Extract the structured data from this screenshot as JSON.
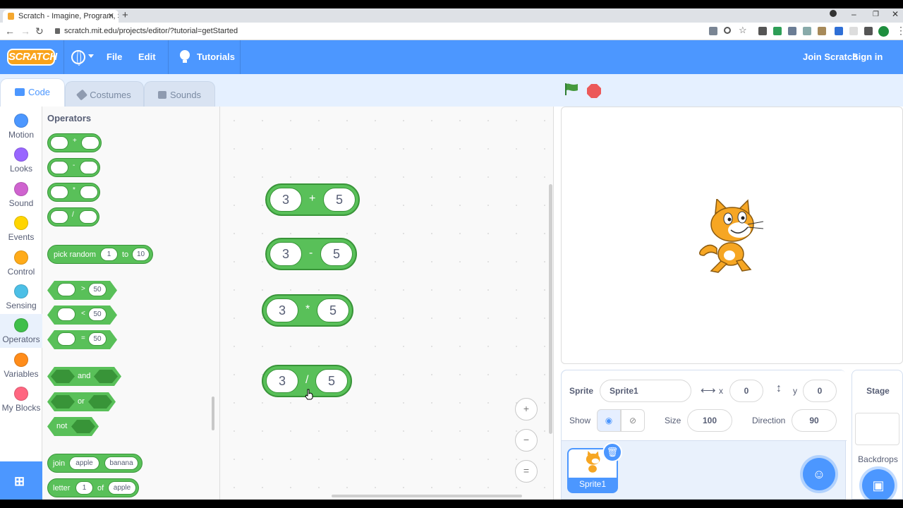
{
  "browser": {
    "tab_title": "Scratch - Imagine, Program, Sh",
    "url": "scratch.mit.edu/projects/editor/?tutorial=getStarted"
  },
  "menu": {
    "logo": "SCRATCH",
    "file": "File",
    "edit": "Edit",
    "tutorials": "Tutorials",
    "join": "Join Scratch",
    "signin": "Sign in"
  },
  "tabs": {
    "code": "Code",
    "costumes": "Costumes",
    "sounds": "Sounds"
  },
  "categories": [
    {
      "label": "Motion",
      "color": "#4c97ff"
    },
    {
      "label": "Looks",
      "color": "#9966ff"
    },
    {
      "label": "Sound",
      "color": "#cf63cf"
    },
    {
      "label": "Events",
      "color": "#ffd500"
    },
    {
      "label": "Control",
      "color": "#ffab19"
    },
    {
      "label": "Sensing",
      "color": "#4cbfe6"
    },
    {
      "label": "Operators",
      "color": "#40bf4a"
    },
    {
      "label": "Variables",
      "color": "#ff8c1a"
    },
    {
      "label": "My Blocks",
      "color": "#ff6680"
    }
  ],
  "palette": {
    "title": "Operators",
    "arith_ops": [
      "+",
      "-",
      "*",
      "/"
    ],
    "pick_random": {
      "label": "pick random",
      "from": "1",
      "to_label": "to",
      "to": "10"
    },
    "compare": [
      {
        "op": ">",
        "value": "50"
      },
      {
        "op": "<",
        "value": "50"
      },
      {
        "op": "=",
        "value": "50"
      }
    ],
    "and_label": "and",
    "or_label": "or",
    "not_label": "not",
    "join": {
      "label": "join",
      "a": "apple",
      "b": "banana"
    },
    "letter": {
      "label": "letter",
      "n": "1",
      "of_label": "of",
      "word": "apple"
    }
  },
  "workspace": {
    "blocks": [
      {
        "a": "3",
        "op": "+",
        "b": "5"
      },
      {
        "a": "3",
        "op": "-",
        "b": "5"
      },
      {
        "a": "3",
        "op": "*",
        "b": "5"
      },
      {
        "a": "3",
        "op": "/",
        "b": "5"
      }
    ],
    "zoom_in": "+",
    "zoom_out": "−",
    "zoom_reset": "="
  },
  "sprite_info": {
    "sprite_label": "Sprite",
    "sprite_name": "Sprite1",
    "x_label": "x",
    "x": "0",
    "y_label": "y",
    "y": "0",
    "show_label": "Show",
    "size_label": "Size",
    "size": "100",
    "direction_label": "Direction",
    "direction": "90"
  },
  "sprite_list": [
    {
      "name": "Sprite1"
    }
  ],
  "stage_panel": {
    "title": "Stage",
    "backdrops": "Backdrops"
  }
}
